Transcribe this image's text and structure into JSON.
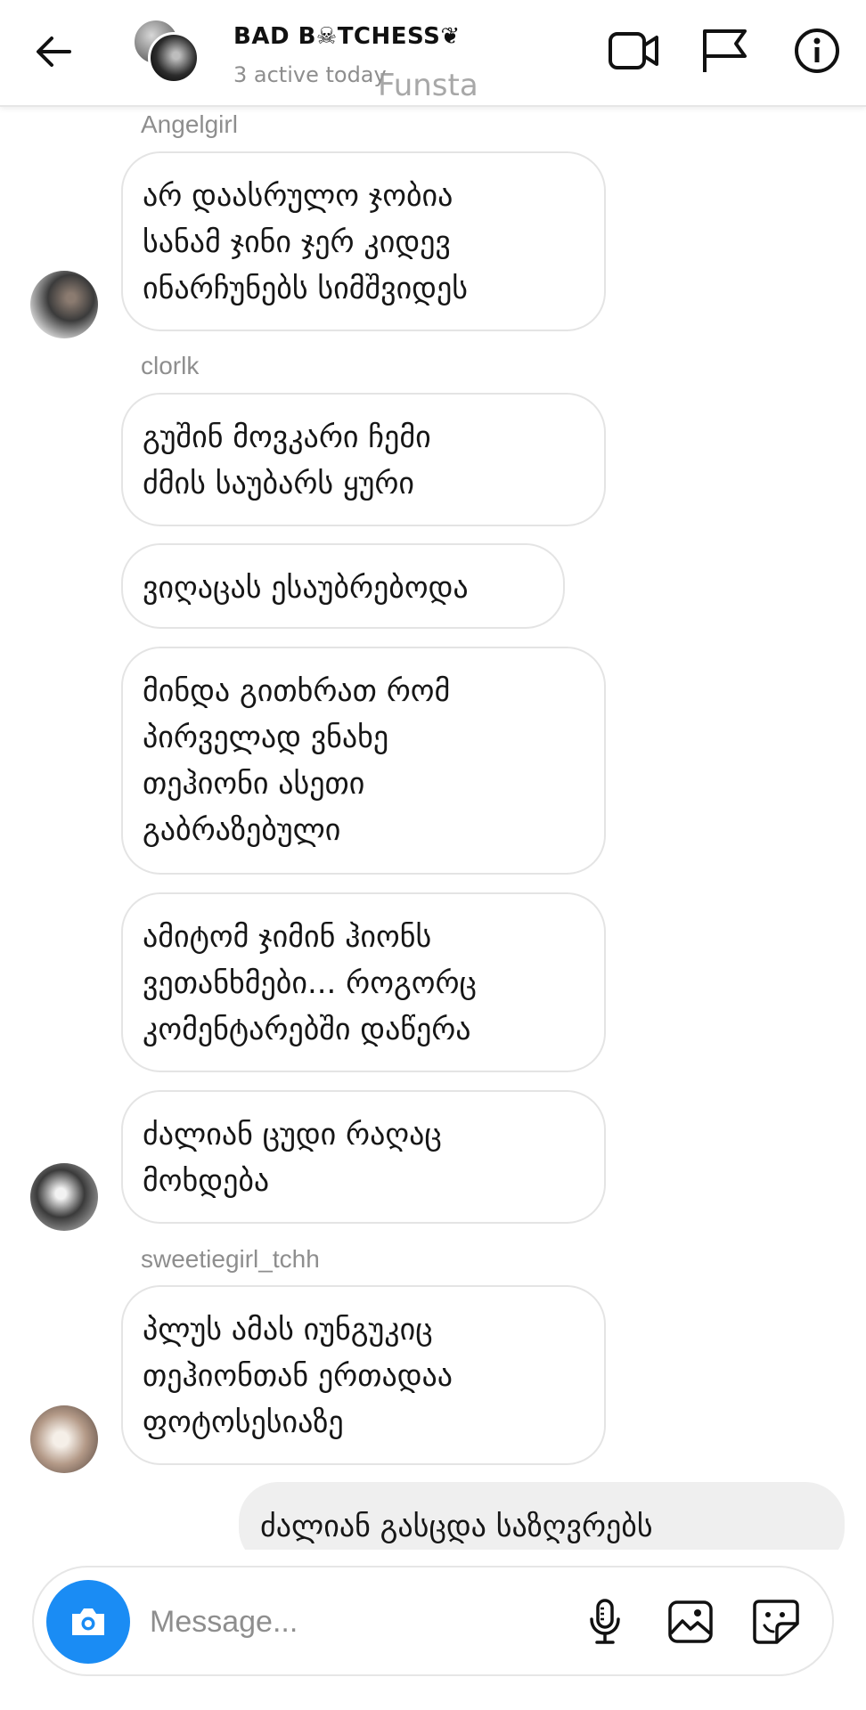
{
  "header": {
    "title": "BAD B☠TCHESS❦",
    "subtitle": "3 active today",
    "watermark": "Funsta"
  },
  "messages": [
    {
      "sender": "Angelgirl",
      "lines": [
        "არ დაასრულო ჯობია",
        "სანამ ჯინი ჯერ კიდევ",
        "ინარჩუნებს სიმშვიდეს"
      ]
    },
    {
      "sender": "clorlk",
      "lines": [
        "გუშინ მოვკარი ჩემი",
        "ძმის საუბარს ყური"
      ]
    },
    {
      "lines": [
        "ვიღაცას ესაუბრებოდა"
      ]
    },
    {
      "lines": [
        "მინდა გითხრათ რომ",
        "პირველად ვნახე",
        "თეჰიონი ასეთი",
        "გაბრაზებული"
      ]
    },
    {
      "lines": [
        "ამიტომ ჯიმინ ჰიონს",
        "ვეთანხმები... როგორც",
        "კომენტარებში დაწერა"
      ]
    },
    {
      "lines": [
        "ძალიან ცუდი რაღაც",
        "მოხდება"
      ]
    },
    {
      "sender": "sweetiegirl_tchh",
      "lines": [
        "პლუს ამას იუნგუკიც",
        "თეჰიონთან ერთადაა",
        "ფოტოსესიაზე"
      ]
    }
  ],
  "own_message": {
    "text": "ძალიან გასცდა საზღვრებს"
  },
  "composer": {
    "placeholder": "Message...",
    "accent_color": "#1a8cf4"
  },
  "icons": [
    "back-arrow-icon",
    "video-camera-icon",
    "flag-icon",
    "info-icon",
    "camera-icon",
    "microphone-icon",
    "gallery-icon",
    "sticker-icon"
  ]
}
